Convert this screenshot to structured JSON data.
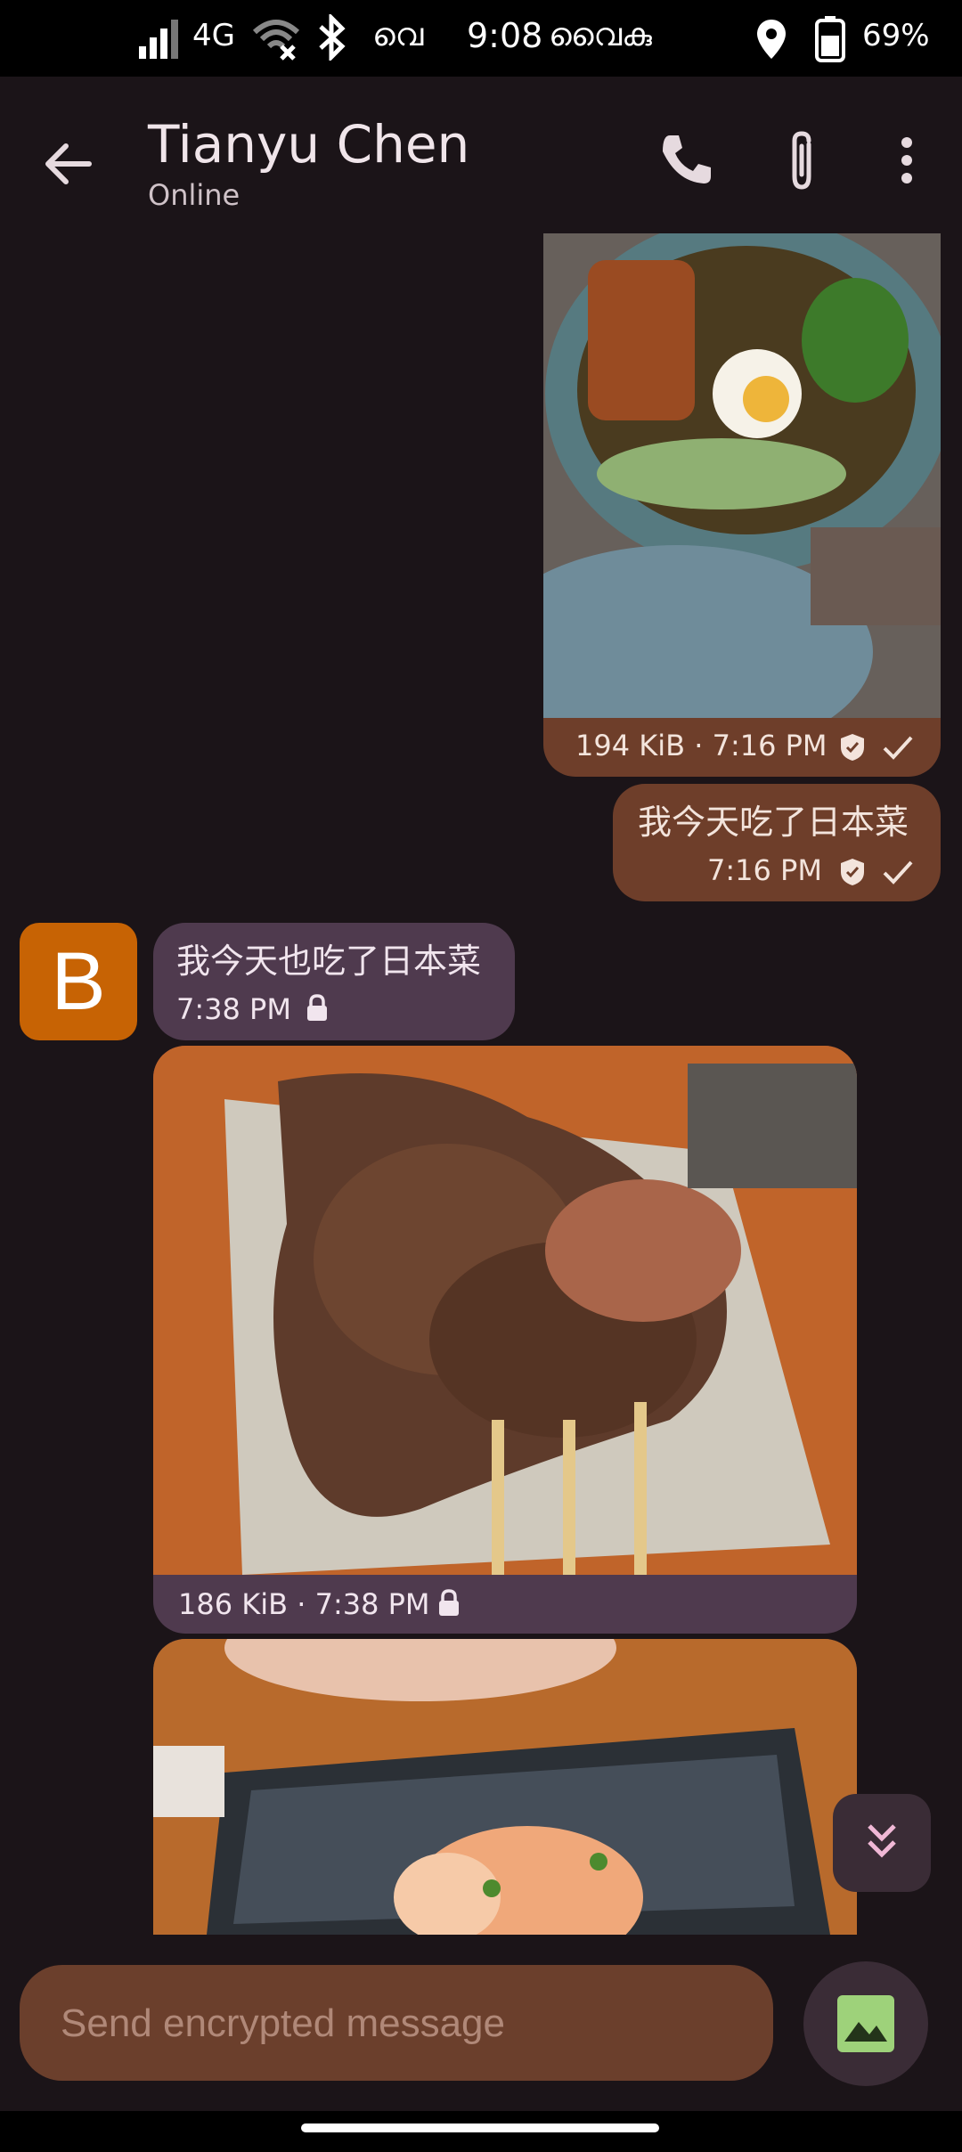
{
  "status_bar": {
    "network": "4G",
    "time": "9:08",
    "time_suffix": "വൈകു",
    "left_label": "വെ",
    "battery": "69%"
  },
  "header": {
    "title": "Tianyu Chen",
    "subtitle": "Online"
  },
  "messages": [
    {
      "direction": "out",
      "type": "image",
      "size": "194 KiB",
      "time": "7:16 PM",
      "meta": "194 KiB · 7:16 PM"
    },
    {
      "direction": "out",
      "type": "text",
      "text": "我今天吃了日本菜",
      "time": "7:16 PM"
    },
    {
      "direction": "in",
      "type": "text",
      "avatar_letter": "B",
      "text": "我今天也吃了日本菜",
      "time": "7:38 PM"
    },
    {
      "direction": "in",
      "type": "image",
      "size": "186 KiB",
      "time": "7:38 PM",
      "meta": "186 KiB · 7:38 PM"
    },
    {
      "direction": "in",
      "type": "image"
    }
  ],
  "composer": {
    "placeholder": "Send encrypted message"
  },
  "colors": {
    "background": "#1b1418",
    "outgoing_bubble": "#6e3e2a",
    "incoming_bubble": "#4f3a4e",
    "avatar": "#c76304",
    "composer": "#6b3f2c"
  },
  "icons": {
    "back": "arrow-left",
    "call": "phone",
    "attach": "paperclip",
    "more": "three-dots-vertical",
    "verified": "shield-check",
    "sent": "check",
    "encrypted": "lock",
    "scroll_down": "double-chevron-down",
    "gallery": "image"
  }
}
